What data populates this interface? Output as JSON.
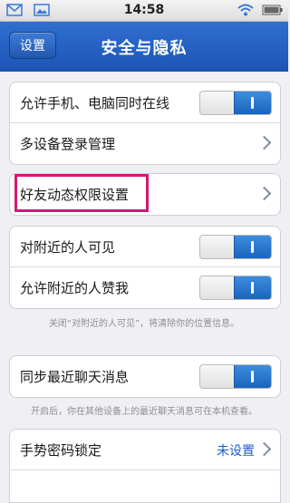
{
  "status_bar": {
    "time": "14:58",
    "icons": [
      "email-icon",
      "image-icon",
      "wifi-icon",
      "battery-icon"
    ]
  },
  "nav": {
    "back_label": "设置",
    "title": "安全与隐私"
  },
  "groups": [
    {
      "rows": [
        {
          "label": "允许手机、电脑同时在线",
          "type": "toggle",
          "on": true
        },
        {
          "label": "多设备登录管理",
          "type": "link"
        }
      ]
    },
    {
      "rows": [
        {
          "label": "好友动态权限设置",
          "type": "link"
        }
      ]
    },
    {
      "rows": [
        {
          "label": "对附近的人可见",
          "type": "toggle",
          "on": true
        },
        {
          "label": "允许附近的人赞我",
          "type": "toggle",
          "on": true
        }
      ],
      "hint": "关闭“对附近的人可见”，将清除你的位置信息。"
    },
    {
      "rows": [
        {
          "label": "同步最近聊天消息",
          "type": "toggle",
          "on": true
        }
      ],
      "hint": "开启后，你在其他设备上的最近聊天消息可在本机查看。"
    },
    {
      "rows": [
        {
          "label": "手势密码锁定",
          "type": "link",
          "value": "未设置"
        }
      ]
    }
  ],
  "colors": {
    "nav_blue": "#1d55b6",
    "toggle_blue": "#1a64bd",
    "highlight": "#d3177a",
    "value_text": "#1d5fc5"
  }
}
